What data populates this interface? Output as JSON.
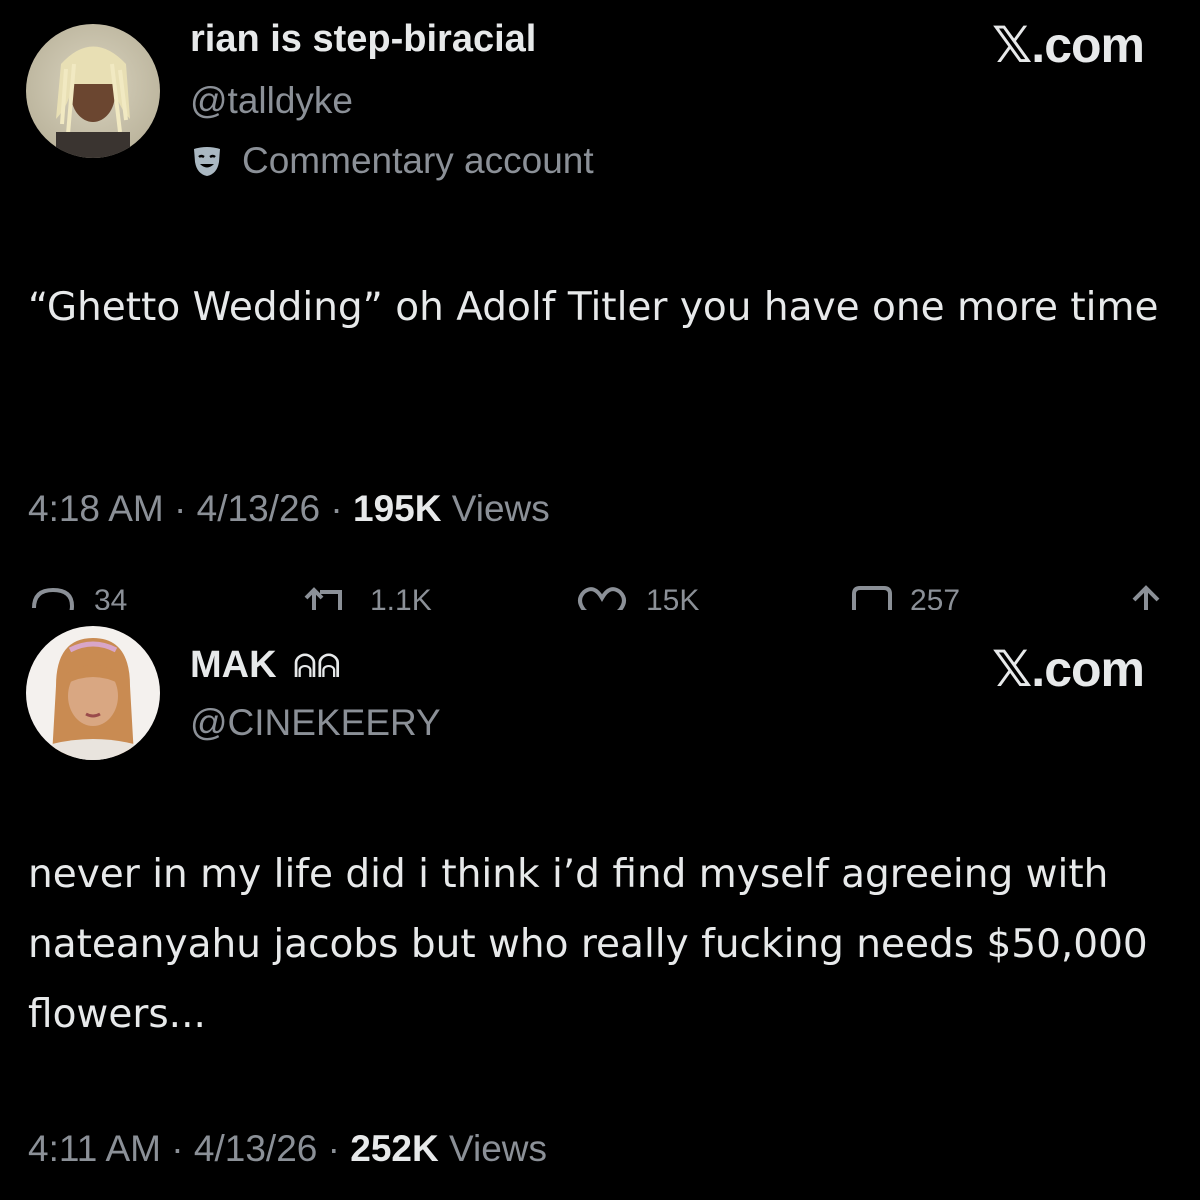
{
  "brand_label": "𝕏.com",
  "tweets": [
    {
      "display_name": "rian is step-biracial",
      "handle": "@talldyke",
      "account_label": "Commentary account",
      "account_label_icon": "theater-mask-icon",
      "text": "“Ghetto Wedding” oh Adolf Titler you have one more time",
      "time": "4:18 AM",
      "date": "4/13/26",
      "views_count": "195K",
      "views_label": "Views",
      "actions": {
        "reply_count": "34",
        "repost_count": "1.1K",
        "like_count": "15K",
        "bookmark_count": "257"
      }
    },
    {
      "display_name": "MAK",
      "name_glyph": "ᕱᕱ",
      "handle": "@CINEKEERY",
      "text": "never in my life did i think i’d find myself agreeing with nateanyahu jacobs but who really fucking needs $50,000 flowers...",
      "time": "4:11 AM",
      "date": "4/13/26",
      "views_count": "252K",
      "views_label": "Views"
    }
  ],
  "colors": {
    "background": "#000000",
    "primary_text": "#e7e9ea",
    "secondary_text": "#8b9097"
  }
}
